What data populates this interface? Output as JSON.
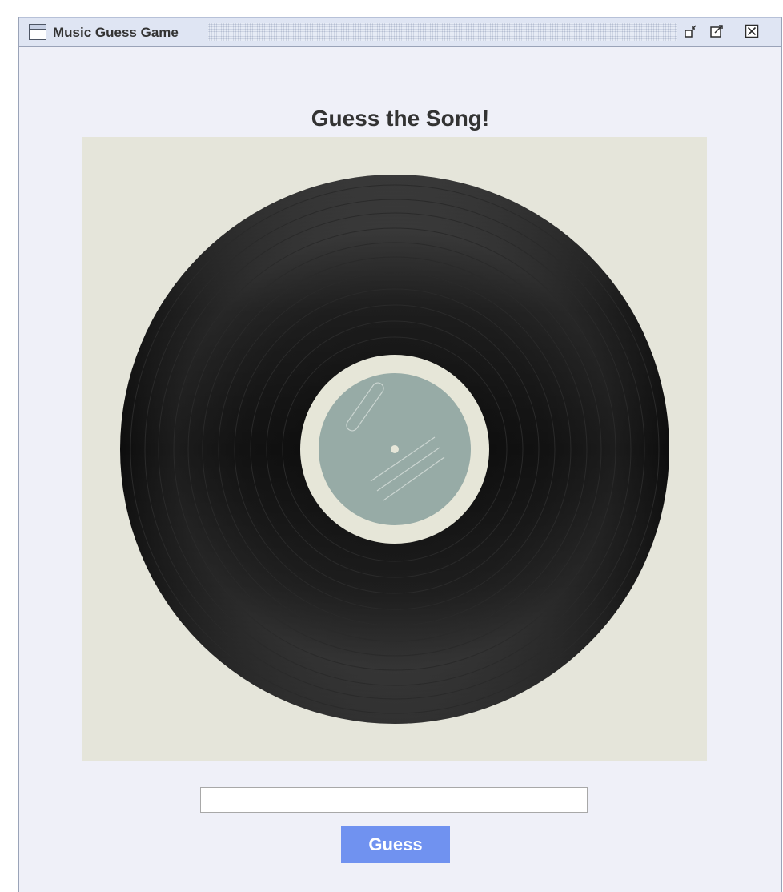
{
  "window": {
    "title": "Music Guess Game",
    "controls": [
      "restore-icon",
      "maximize-icon",
      "close-icon"
    ]
  },
  "main": {
    "heading": "Guess the Song!",
    "image": {
      "description_icon": "vinyl-record-icon",
      "label_colors": {
        "label": "#97aba6",
        "outer_ring": "#e6e6d8",
        "record": "#141414"
      }
    },
    "input": {
      "value": "",
      "placeholder": ""
    },
    "guess_button": {
      "label": "Guess"
    }
  },
  "colors": {
    "background": "#eff0f8",
    "titlebar": "#dfe5f3",
    "button": "#7092f0",
    "heading_text": "#333333"
  }
}
